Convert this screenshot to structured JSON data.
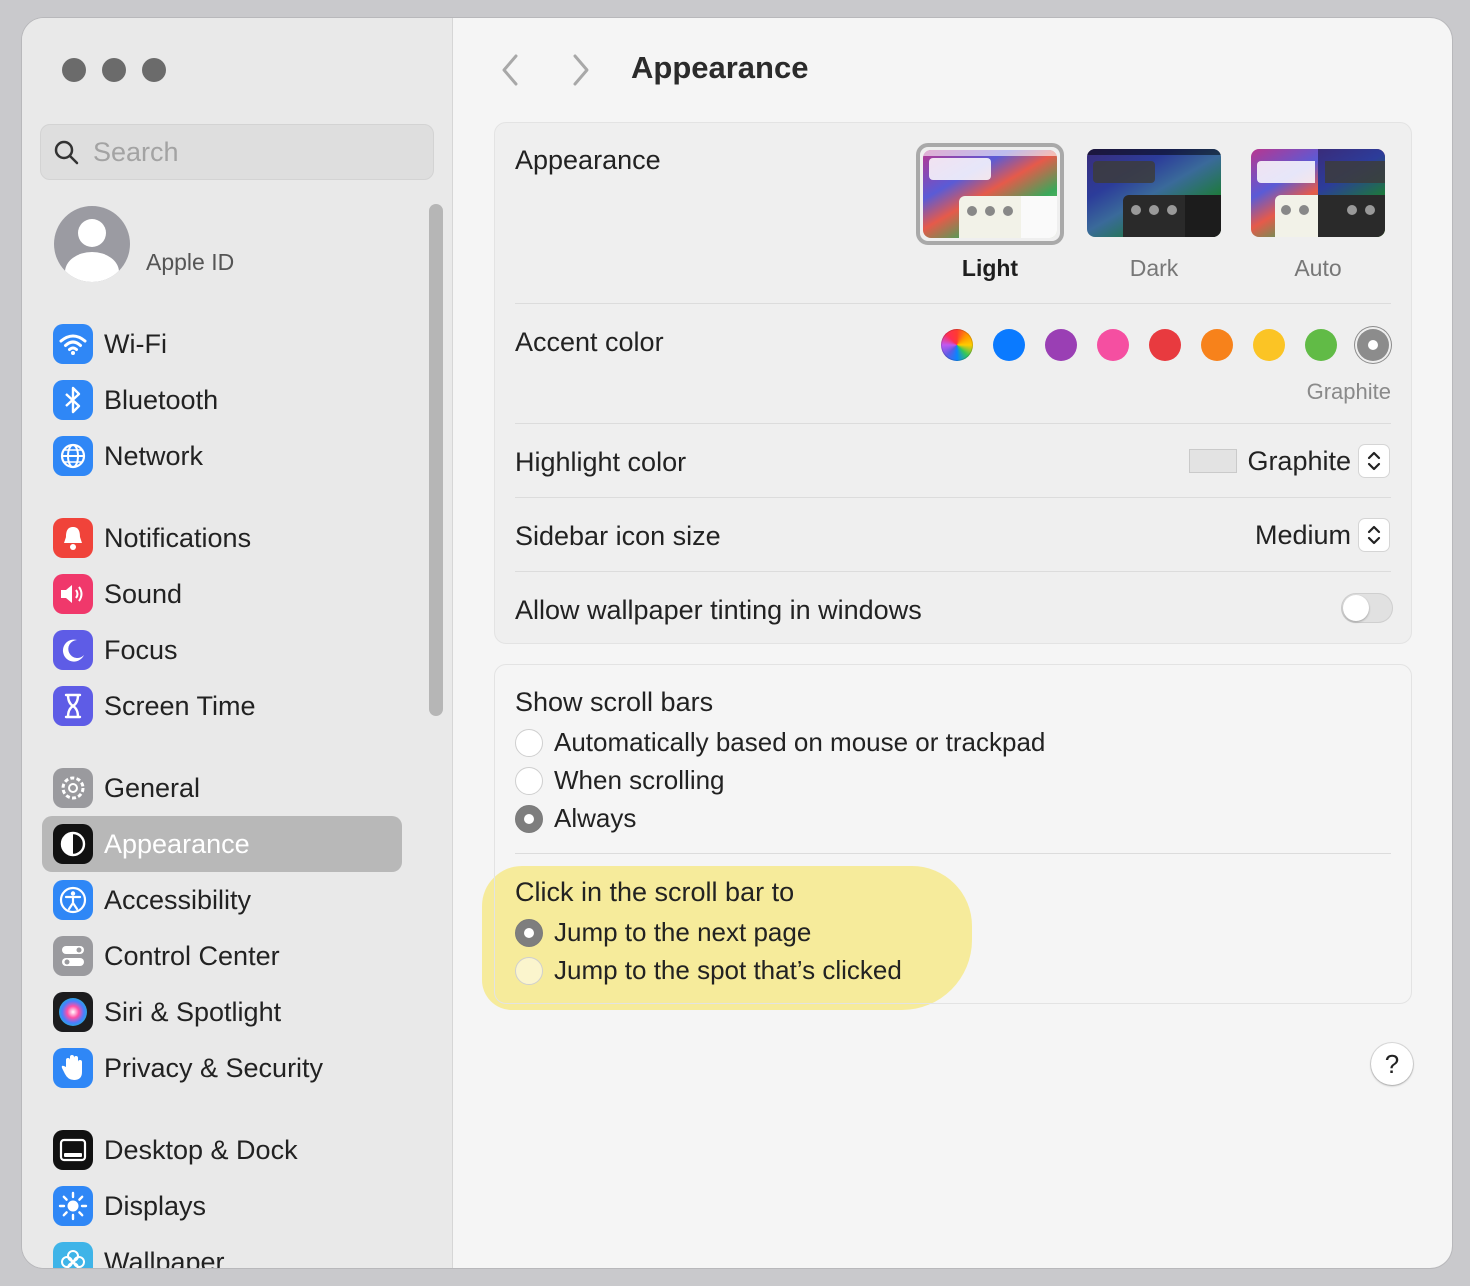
{
  "sidebar": {
    "search_placeholder": "Search",
    "apple_id_label": "Apple ID",
    "items": [
      {
        "label": "Wi-Fi",
        "icon": "wifi-icon",
        "color": "#2f87f6"
      },
      {
        "label": "Bluetooth",
        "icon": "bluetooth-icon",
        "color": "#2f87f6"
      },
      {
        "label": "Network",
        "icon": "globe-icon",
        "color": "#2f87f6"
      },
      {
        "label": "Notifications",
        "icon": "bell-icon",
        "color": "#f0433a"
      },
      {
        "label": "Sound",
        "icon": "speaker-icon",
        "color": "#f0386b"
      },
      {
        "label": "Focus",
        "icon": "moon-icon",
        "color": "#5e5ce6"
      },
      {
        "label": "Screen Time",
        "icon": "hourglass-icon",
        "color": "#5e5ce6"
      },
      {
        "label": "General",
        "icon": "gear-icon",
        "color": "#9a9a9e"
      },
      {
        "label": "Appearance",
        "icon": "appearance-icon",
        "color": "#111111",
        "selected": true
      },
      {
        "label": "Accessibility",
        "icon": "accessibility-icon",
        "color": "#2f87f6"
      },
      {
        "label": "Control Center",
        "icon": "toggles-icon",
        "color": "#9a9a9e"
      },
      {
        "label": "Siri & Spotlight",
        "icon": "siri-icon",
        "color": "#3a3a3c"
      },
      {
        "label": "Privacy & Security",
        "icon": "hand-icon",
        "color": "#2f87f6"
      },
      {
        "label": "Desktop & Dock",
        "icon": "dock-icon",
        "color": "#111111"
      },
      {
        "label": "Displays",
        "icon": "sun-icon",
        "color": "#2f87f6"
      },
      {
        "label": "Wallpaper",
        "icon": "flower-icon",
        "color": "#3fb4e8"
      }
    ]
  },
  "toolbar": {
    "title": "Appearance"
  },
  "appearance": {
    "section_label": "Appearance",
    "options": [
      {
        "label": "Light",
        "selected": true
      },
      {
        "label": "Dark",
        "selected": false
      },
      {
        "label": "Auto",
        "selected": false
      }
    ]
  },
  "accent": {
    "label": "Accent color",
    "selected_name": "Graphite",
    "colors": [
      "multicolor",
      "#0a7aff",
      "#9a3fb4",
      "#f54fa1",
      "#e83a3f",
      "#f7821b",
      "#fbc425",
      "#61bb46",
      "#8c8c8c"
    ]
  },
  "highlight": {
    "label": "Highlight color",
    "value": "Graphite"
  },
  "sidebar_icon_size": {
    "label": "Sidebar icon size",
    "value": "Medium"
  },
  "wallpaper_tinting": {
    "label": "Allow wallpaper tinting in windows",
    "enabled": false
  },
  "scroll_bars": {
    "label": "Show scroll bars",
    "options": [
      {
        "label": "Automatically based on mouse or trackpad",
        "selected": false
      },
      {
        "label": "When scrolling",
        "selected": false
      },
      {
        "label": "Always",
        "selected": true
      }
    ]
  },
  "click_scroll": {
    "label": "Click in the scroll bar to",
    "options": [
      {
        "label": "Jump to the next page",
        "selected": true
      },
      {
        "label": "Jump to the spot that’s clicked",
        "selected": false
      }
    ]
  },
  "help_label": "?"
}
